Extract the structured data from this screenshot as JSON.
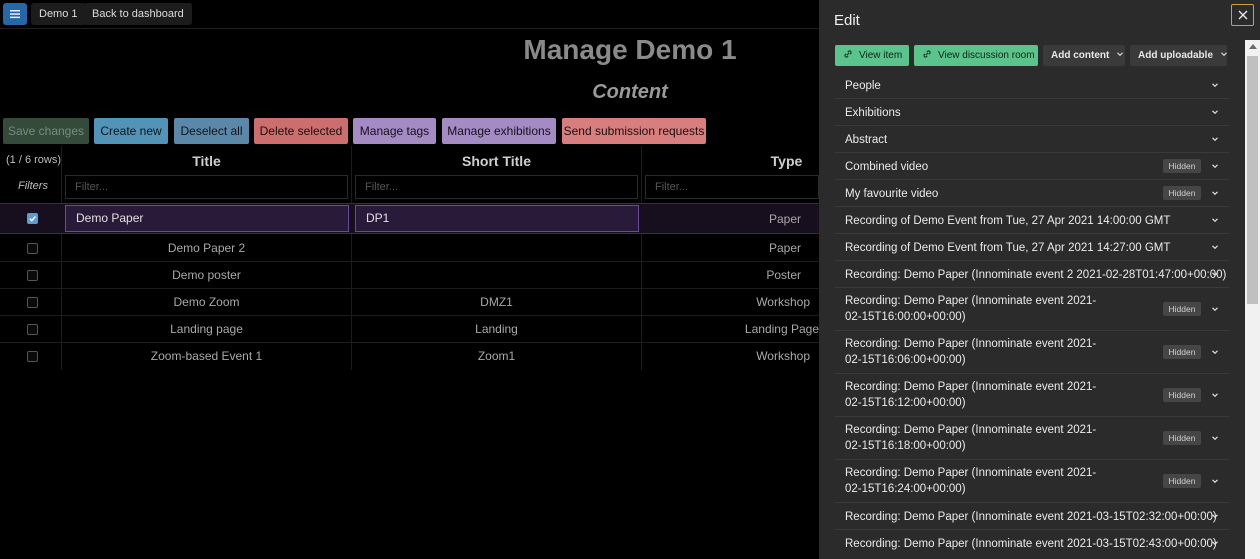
{
  "topbar": {
    "menu_icon": "hamburger-icon",
    "demo_label": "Demo 1",
    "back_label": "Back to dashboard"
  },
  "page": {
    "title": "Manage Demo 1",
    "section": "Content"
  },
  "actions": {
    "save": "Save changes",
    "create": "Create new",
    "deselect": "Deselect all",
    "delete": "Delete selected",
    "tags": "Manage tags",
    "exhibitions": "Manage exhibitions",
    "submission": "Send submission requests"
  },
  "table": {
    "row_count": "(1 / 6 rows)",
    "filters_label": "Filters",
    "filter_placeholder": "Filter...",
    "columns": [
      "Title",
      "Short Title",
      "Type"
    ],
    "rows": [
      {
        "selected": true,
        "title": "Demo Paper",
        "short": "DP1",
        "type": "Paper"
      },
      {
        "selected": false,
        "title": "Demo Paper 2",
        "short": "",
        "type": "Paper"
      },
      {
        "selected": false,
        "title": "Demo poster",
        "short": "",
        "type": "Poster"
      },
      {
        "selected": false,
        "title": "Demo Zoom",
        "short": "DMZ1",
        "type": "Workshop"
      },
      {
        "selected": false,
        "title": "Landing page",
        "short": "Landing",
        "type": "Landing Page"
      },
      {
        "selected": false,
        "title": "Zoom-based Event 1",
        "short": "Zoom1",
        "type": "Workshop"
      }
    ]
  },
  "edit_panel": {
    "title": "Edit",
    "close_icon": "close-icon",
    "view_item": "View item",
    "view_discussion": "View discussion room",
    "add_content": "Add content",
    "add_uploadable": "Add uploadable",
    "hidden_label": "Hidden",
    "items": [
      {
        "label": "People",
        "hidden": false,
        "lines": 1
      },
      {
        "label": "Exhibitions",
        "hidden": false,
        "lines": 1
      },
      {
        "label": "Abstract",
        "hidden": false,
        "lines": 1
      },
      {
        "label": "Combined video",
        "hidden": true,
        "lines": 1
      },
      {
        "label": "My favourite video",
        "hidden": true,
        "lines": 1
      },
      {
        "label": "Recording of Demo Event from Tue, 27 Apr 2021 14:00:00 GMT",
        "hidden": false,
        "lines": 1
      },
      {
        "label": "Recording of Demo Event from Tue, 27 Apr 2021 14:27:00 GMT",
        "hidden": false,
        "lines": 1
      },
      {
        "label": "Recording: Demo Paper (Innominate event 2 2021-02-28T01:47:00+00:00)",
        "hidden": false,
        "lines": 1
      },
      {
        "label": "Recording: Demo Paper (Innominate event 2021-02-15T16:00:00+00:00)",
        "hidden": true,
        "lines": 2
      },
      {
        "label": "Recording: Demo Paper (Innominate event 2021-02-15T16:06:00+00:00)",
        "hidden": true,
        "lines": 2
      },
      {
        "label": "Recording: Demo Paper (Innominate event 2021-02-15T16:12:00+00:00)",
        "hidden": true,
        "lines": 2
      },
      {
        "label": "Recording: Demo Paper (Innominate event 2021-02-15T16:18:00+00:00)",
        "hidden": true,
        "lines": 2
      },
      {
        "label": "Recording: Demo Paper (Innominate event 2021-02-15T16:24:00+00:00)",
        "hidden": true,
        "lines": 2
      },
      {
        "label": "Recording: Demo Paper (Innominate event 2021-03-15T02:32:00+00:00)",
        "hidden": false,
        "lines": 1
      },
      {
        "label": "Recording: Demo Paper (Innominate event 2021-03-15T02:43:00+00:00)",
        "hidden": false,
        "lines": 1
      }
    ]
  }
}
